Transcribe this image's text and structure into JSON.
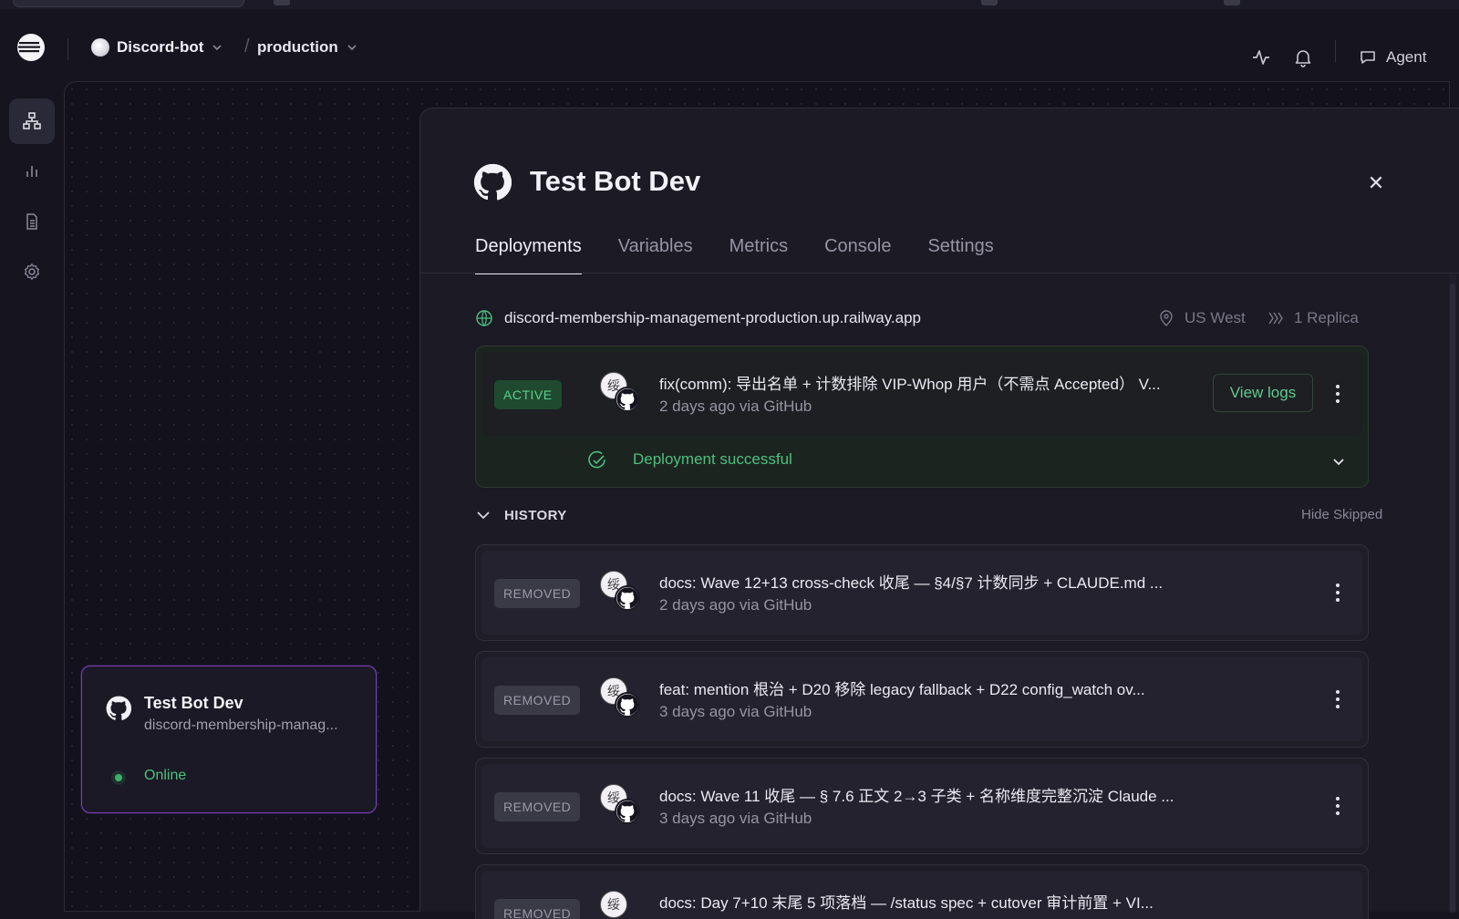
{
  "header": {
    "project_name": "Discord-bot",
    "environment": "production",
    "agent_label": "Agent"
  },
  "service_card": {
    "title": "Test Bot Dev",
    "subtitle": "discord-membership-manag...",
    "status": "Online"
  },
  "panel": {
    "title": "Test Bot Dev",
    "tabs": [
      "Deployments",
      "Variables",
      "Metrics",
      "Console",
      "Settings"
    ],
    "active_tab": "Deployments",
    "url": "discord-membership-management-production.up.railway.app",
    "region": "US West",
    "replicas": "1 Replica"
  },
  "active_deployment": {
    "badge": "ACTIVE",
    "commit": "fix(comm): 导出名单 + 计数排除 VIP-Whop 用户（不需点 Accepted） V...",
    "meta": "2 days ago via GitHub",
    "view_logs": "View logs",
    "status": "Deployment successful"
  },
  "history": {
    "label": "HISTORY",
    "hide_skipped": "Hide Skipped",
    "items": [
      {
        "badge": "REMOVED",
        "commit": "docs: Wave 12+13 cross-check 收尾 — §4/§7 计数同步 + CLAUDE.md ...",
        "meta": "2 days ago via GitHub"
      },
      {
        "badge": "REMOVED",
        "commit": "feat: mention 根治 + D20 移除 legacy fallback + D22 config_watch ov...",
        "meta": "3 days ago via GitHub"
      },
      {
        "badge": "REMOVED",
        "commit": "docs: Wave 11 收尾 — § 7.6 正文 2→3 子类 + 名称维度完整沉淀 Claude ...",
        "meta": "3 days ago via GitHub"
      },
      {
        "badge": "REMOVED",
        "commit": "docs: Day 7+10 末尾 5 项落档 — /status spec + cutover 审计前置 + VI...",
        "meta": ""
      }
    ]
  },
  "colors": {
    "accent_green": "#4fbf7d",
    "service_border": "#7c3fb8",
    "background": "#15141f"
  }
}
